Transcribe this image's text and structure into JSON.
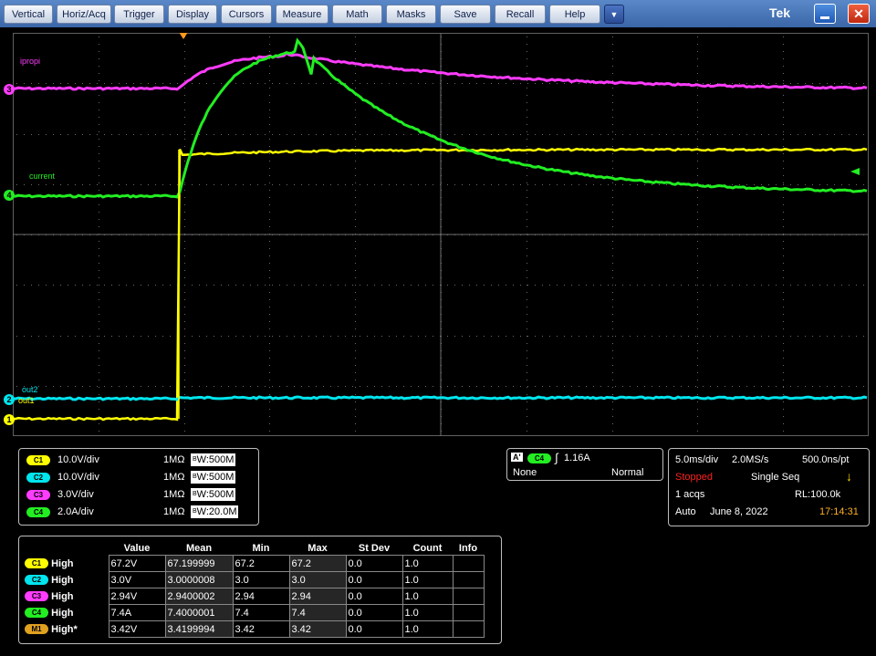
{
  "menubar": {
    "buttons": [
      "Vertical",
      "Horiz/Acq",
      "Trigger",
      "Display",
      "Cursors",
      "Measure",
      "Math",
      "Masks",
      "Save",
      "Recall",
      "Help"
    ],
    "dropdown_icon": "chevron-down-icon",
    "brand": "Tek",
    "minimize_icon": "minimize-icon",
    "close_icon": "close-icon"
  },
  "colors": {
    "ch1": "#ffff00",
    "ch2": "#00e5ee",
    "ch3": "#ff3cff",
    "ch4": "#22ee22"
  },
  "waveform": {
    "markers": [
      {
        "id": "ch1-marker",
        "label": "1",
        "color": "#ffff00"
      },
      {
        "id": "ch2-marker",
        "label": "2",
        "color": "#00e5ee"
      },
      {
        "id": "ch3-marker",
        "label": "3",
        "color": "#ff3cff"
      },
      {
        "id": "ch4-marker",
        "label": "4",
        "color": "#22ee22"
      }
    ],
    "trace_labels": {
      "ch3": "ipropi",
      "ch4": "current",
      "ch2": "out2",
      "ch1": "out1"
    }
  },
  "vertical": [
    {
      "chip": "C1",
      "color": "#ffff00",
      "scale": "10.0V/div",
      "impedance": "1MΩ",
      "bw_tag": "B",
      "bw": "W:500M"
    },
    {
      "chip": "C2",
      "color": "#00e5ee",
      "scale": "10.0V/div",
      "impedance": "1MΩ",
      "bw_tag": "B",
      "bw": "W:500M"
    },
    {
      "chip": "C3",
      "color": "#ff3cff",
      "scale": "3.0V/div",
      "impedance": "1MΩ",
      "bw_tag": "B",
      "bw": "W:500M"
    },
    {
      "chip": "C4",
      "color": "#22ee22",
      "scale": "2.0A/div",
      "impedance": "1MΩ",
      "bw_tag": "B",
      "bw": "W:20.0M"
    }
  ],
  "trigger": {
    "badge": "A'",
    "source": "C4",
    "level": "1.16A",
    "coupling": "None",
    "mode": "Normal"
  },
  "horizontal": {
    "time_div": "5.0ms/div",
    "sample_rate": "2.0MS/s",
    "resolution": "500.0ns/pt",
    "status": "Stopped",
    "acq_mode": "Single Seq",
    "acqs": "1 acqs",
    "record_length": "RL:100.0k",
    "trigger_mode": "Auto",
    "date": "June 8, 2022",
    "time": "17:14:31"
  },
  "measurements": {
    "headers": [
      "Value",
      "Mean",
      "Min",
      "Max",
      "St Dev",
      "Count",
      "Info"
    ],
    "rows": [
      {
        "chip": "C1",
        "color": "#ffff00",
        "type": "High",
        "value": "67.2V",
        "mean": "67.199999",
        "min": "67.2",
        "max": "67.2",
        "stdev": "0.0",
        "count": "1.0",
        "info": ""
      },
      {
        "chip": "C2",
        "color": "#00e5ee",
        "type": "High",
        "value": "3.0V",
        "mean": "3.0000008",
        "min": "3.0",
        "max": "3.0",
        "stdev": "0.0",
        "count": "1.0",
        "info": ""
      },
      {
        "chip": "C3",
        "color": "#ff3cff",
        "type": "High",
        "value": "2.94V",
        "mean": "2.9400002",
        "min": "2.94",
        "max": "2.94",
        "stdev": "0.0",
        "count": "1.0",
        "info": ""
      },
      {
        "chip": "C4",
        "color": "#22ee22",
        "type": "High",
        "value": "7.4A",
        "mean": "7.4000001",
        "min": "7.4",
        "max": "7.4",
        "stdev": "0.0",
        "count": "1.0",
        "info": ""
      },
      {
        "chip": "M1",
        "color": "#e0a020",
        "type": "High*",
        "value": "3.42V",
        "mean": "3.4199994",
        "min": "3.42",
        "max": "3.42",
        "stdev": "0.0",
        "count": "1.0",
        "info": ""
      }
    ]
  }
}
